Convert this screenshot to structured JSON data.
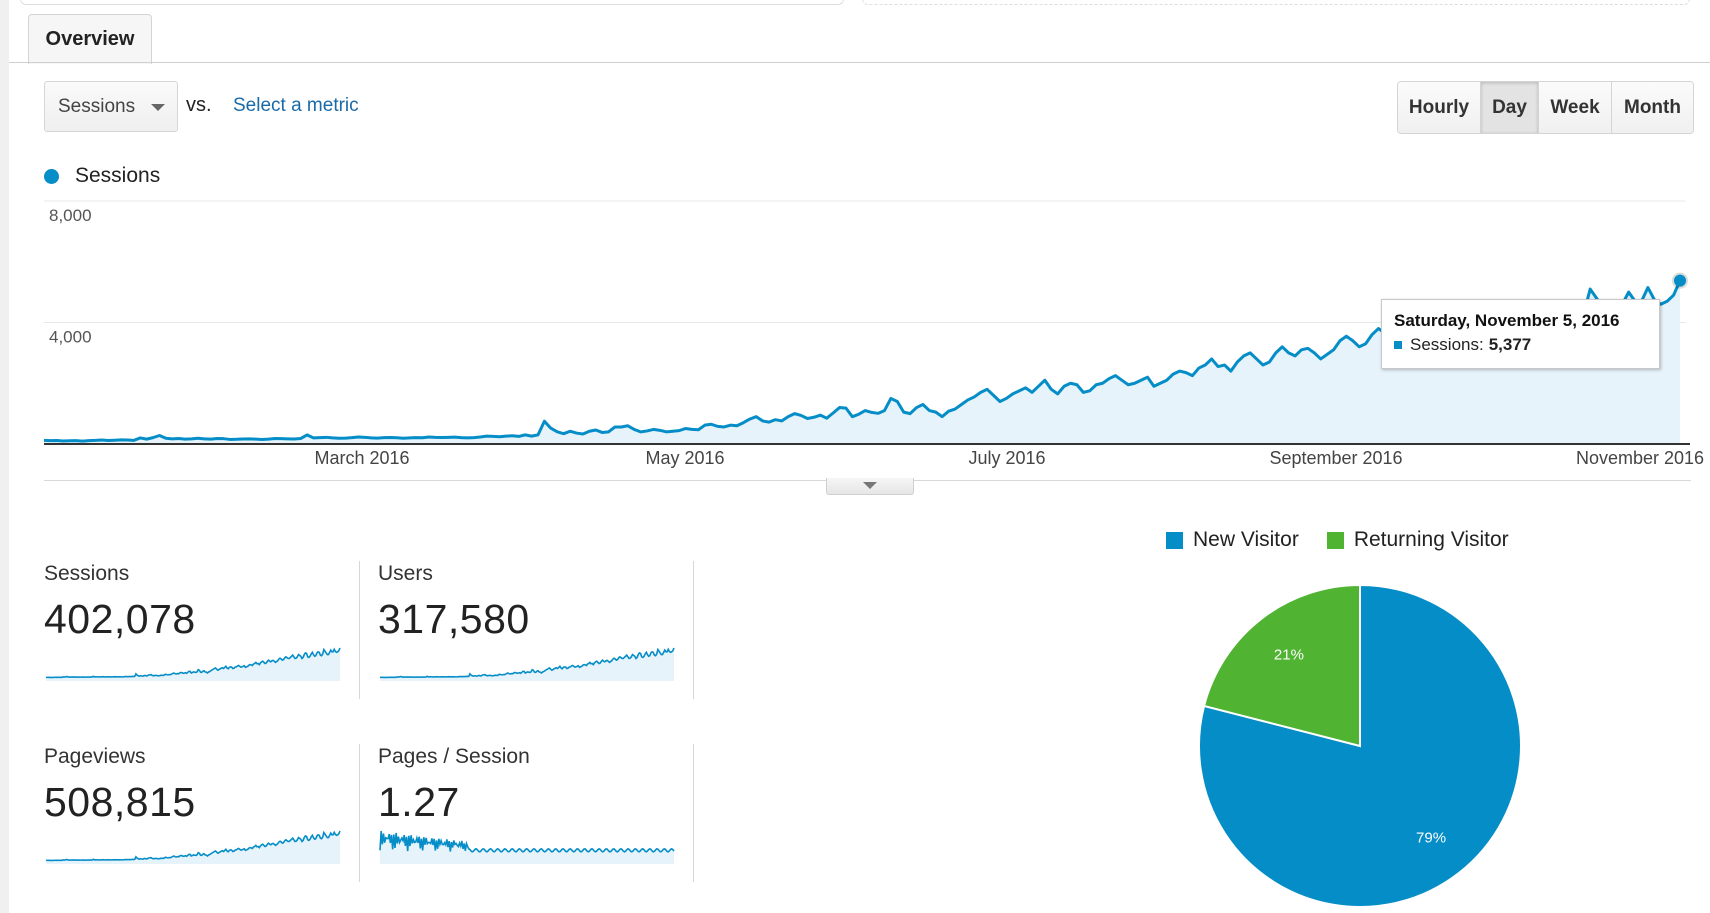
{
  "tabs": [
    {
      "label": "Overview",
      "active": true
    }
  ],
  "metric_selector": {
    "selected": "Sessions",
    "vs_label": "vs.",
    "compare_link": "Select a metric"
  },
  "granularity": {
    "options": [
      {
        "label": "Hourly",
        "active": false
      },
      {
        "label": "Day",
        "active": true
      },
      {
        "label": "Week",
        "active": false
      },
      {
        "label": "Month",
        "active": false
      }
    ]
  },
  "colors": {
    "primary": "#058dc7",
    "secondary": "#50b432",
    "fill": "#e6f3fa"
  },
  "tooltip": {
    "date": "Saturday, November 5, 2016",
    "metric": "Sessions:",
    "value": "5,377"
  },
  "chart_data": [
    {
      "type": "area",
      "title": "",
      "legend": [
        "Sessions"
      ],
      "legend_position": "top-left",
      "ylabel": "",
      "xlabel": "",
      "ylim": [
        0,
        8000
      ],
      "y_ticks": [
        "8,000",
        "4,000"
      ],
      "x_ticks": [
        "March 2016",
        "May 2016",
        "July 2016",
        "September 2016",
        "November 2016"
      ],
      "x_range": [
        "2016-01-01",
        "2016-11-05"
      ],
      "grid": true,
      "series": [
        {
          "name": "Sessions",
          "values": [
            120,
            110,
            115,
            100,
            105,
            110,
            95,
            110,
            120,
            130,
            115,
            125,
            135,
            130,
            120,
            200,
            160,
            210,
            280,
            190,
            170,
            180,
            160,
            170,
            190,
            170,
            160,
            180,
            175,
            150,
            155,
            165,
            170,
            160,
            150,
            160,
            180,
            175,
            170,
            165,
            180,
            300,
            200,
            210,
            220,
            200,
            190,
            195,
            210,
            230,
            220,
            200,
            195,
            210,
            215,
            205,
            190,
            200,
            210,
            205,
            230,
            220,
            215,
            220,
            225,
            210,
            200,
            210,
            230,
            260,
            250,
            240,
            260,
            270,
            250,
            300,
            260,
            300,
            750,
            520,
            400,
            340,
            420,
            360,
            330,
            420,
            460,
            380,
            400,
            560,
            560,
            600,
            480,
            400,
            430,
            480,
            450,
            400,
            420,
            440,
            510,
            480,
            470,
            620,
            650,
            580,
            560,
            620,
            600,
            700,
            820,
            900,
            760,
            720,
            800,
            760,
            900,
            1000,
            940,
            840,
            880,
            950,
            850,
            1020,
            1200,
            1180,
            900,
            980,
            1100,
            1040,
            1010,
            1100,
            1500,
            1400,
            1050,
            1000,
            1200,
            1300,
            1100,
            1050,
            900,
            1080,
            1150,
            1300,
            1450,
            1550,
            1700,
            1800,
            1600,
            1400,
            1500,
            1650,
            1750,
            1850,
            1700,
            1900,
            2100,
            1800,
            1650,
            1900,
            2000,
            1950,
            1700,
            1750,
            1950,
            2000,
            2150,
            2250,
            2100,
            1950,
            2000,
            2100,
            2200,
            1900,
            2000,
            2100,
            2300,
            2400,
            2350,
            2250,
            2500,
            2600,
            2800,
            2550,
            2600,
            2400,
            2700,
            2900,
            3000,
            2800,
            2600,
            2700,
            3000,
            3200,
            3000,
            2900,
            3100,
            3150,
            3000,
            2800,
            2950,
            3100,
            3400,
            3550,
            3400,
            3200,
            3300,
            3600,
            3800,
            3650,
            3500,
            3500,
            3700,
            3900,
            4100,
            3800,
            3500,
            3550,
            3800,
            4200,
            4050,
            3900,
            3500,
            3700,
            4200,
            4500,
            4400,
            3800,
            3700,
            3900,
            4300,
            4600,
            4200,
            3900,
            4000,
            4500,
            4700,
            4600,
            4100,
            4000,
            4300,
            5100,
            4800,
            4500,
            4200,
            4200,
            4600,
            5000,
            4700,
            4700,
            5150,
            4750,
            4600,
            4700,
            4900,
            5377
          ]
        }
      ],
      "highlight": {
        "x": "2016-11-05",
        "label": "Saturday, November 5, 2016",
        "value": 5377
      }
    },
    {
      "type": "pie",
      "title": "",
      "legend": [
        "New Visitor",
        "Returning Visitor"
      ],
      "legend_position": "top",
      "categories": [
        "New Visitor",
        "Returning Visitor"
      ],
      "values": [
        79,
        21
      ],
      "labels": [
        "79%",
        "21%"
      ]
    }
  ],
  "scorecards": [
    {
      "label": "Sessions",
      "value": "402,078",
      "trend": "sessions"
    },
    {
      "label": "Users",
      "value": "317,580",
      "trend": "sessions"
    },
    {
      "label": "Pageviews",
      "value": "508,815",
      "trend": "sessions"
    },
    {
      "label": "Pages / Session",
      "value": "1.27",
      "trend": "pps"
    }
  ]
}
